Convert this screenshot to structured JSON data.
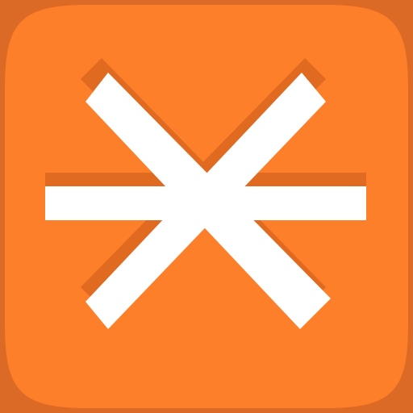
{
  "icon": {
    "name": "asterisk-snowflake-app-icon",
    "colors": {
      "background": "#DB6A26",
      "tile": "#FE7F2A",
      "shadow": "#E06A20",
      "glyph": "#FFFFFF"
    }
  }
}
